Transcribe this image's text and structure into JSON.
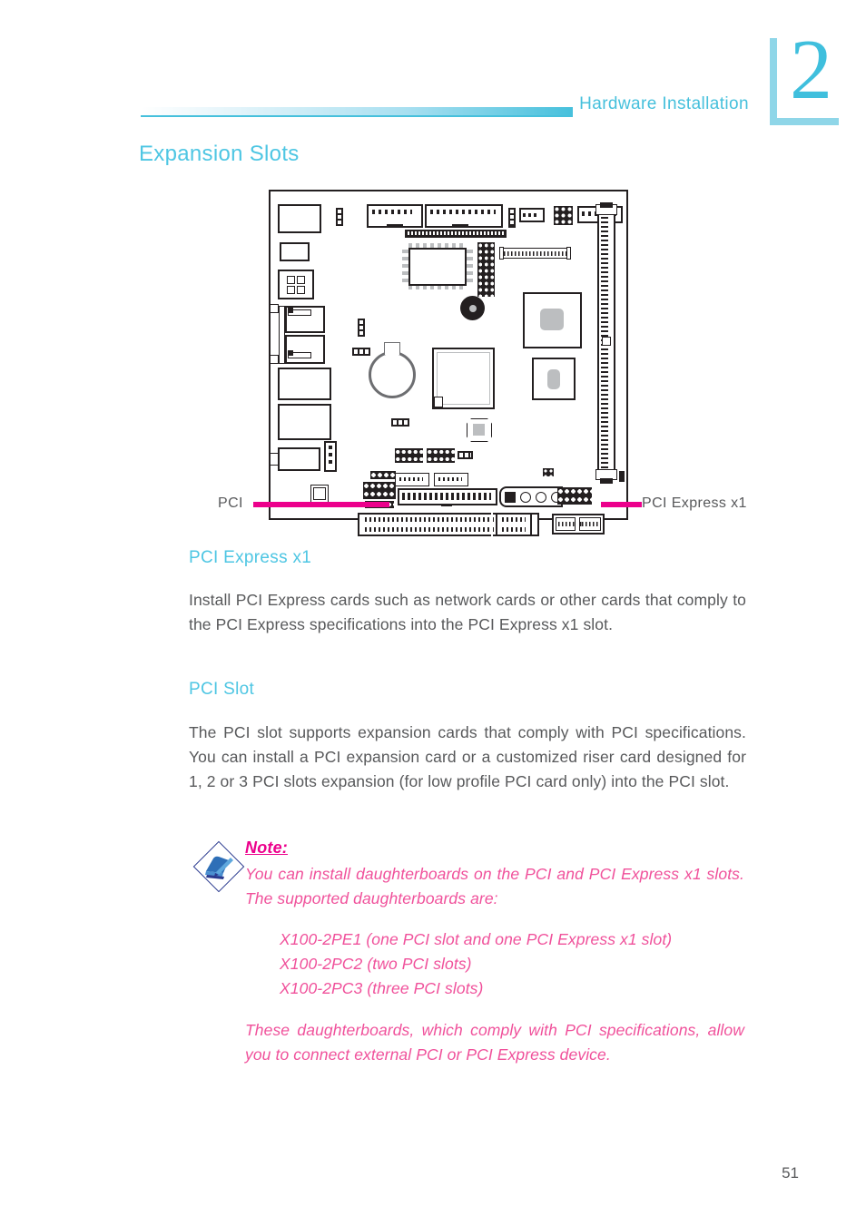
{
  "chapter": {
    "number": "2"
  },
  "running_head": {
    "title": "Hardware Installation"
  },
  "section": {
    "title": "Expansion Slots"
  },
  "figure": {
    "caption_left": "PCI",
    "caption_right": "PCI Express x1"
  },
  "pcie_section": {
    "heading": "PCI Express x1",
    "body": "Install PCI Express cards such as network cards or other cards that comply to the PCI Express specifications into the PCI Express x1 slot."
  },
  "pci_section": {
    "heading": "PCI Slot",
    "body": "The PCI slot supports expansion cards that comply with PCI specifications. You can install a PCI expansion card or a customized riser card  designed for 1, 2 or 3 PCI slots expansion (for low profile PCI card only) into the PCI slot."
  },
  "note": {
    "label": "Note:",
    "body": "You can install daughterboards on the PCI and PCI Express x1 slots. The supported daughterboards are:",
    "items": [
      "X100-2PE1 (one PCI slot and one PCI Express x1 slot)",
      "X100-2PC2 (two PCI slots)",
      "X100-2PC3 (three PCI slots)"
    ],
    "footer": "These daughterboards, which comply with PCI specifications, allow you to connect external PCI or PCI Express device."
  },
  "footer": {
    "page_number": "51"
  },
  "colors": {
    "accent_cyan": "#4ec6e3",
    "accent_cyan_light": "#8fd6e8",
    "magenta": "#ec008c",
    "note_pink": "#f0519b",
    "body_gray": "#58595b",
    "board_ink": "#231f20"
  }
}
